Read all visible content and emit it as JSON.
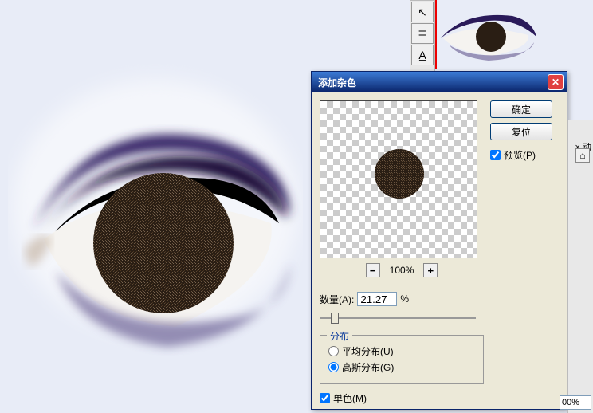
{
  "dialog": {
    "title": "添加杂色",
    "ok_label": "确定",
    "reset_label": "复位",
    "preview_label": "预览(P)",
    "zoom_level": "100%",
    "amount_label": "数量(A):",
    "amount_value": "21.27",
    "amount_unit": "%",
    "distribution_label": "分布",
    "uniform_label": "平均分布(U)",
    "gaussian_label": "高斯分布(G)",
    "mono_label": "单色(M)"
  },
  "toolbar": {
    "icons": [
      "move-icon",
      "letter-icon",
      "a-icon"
    ]
  },
  "right": {
    "tab": "动",
    "close": "×",
    "percent": "00%"
  },
  "colors": {
    "accent": "#0a246a",
    "group_title": "#003399"
  }
}
